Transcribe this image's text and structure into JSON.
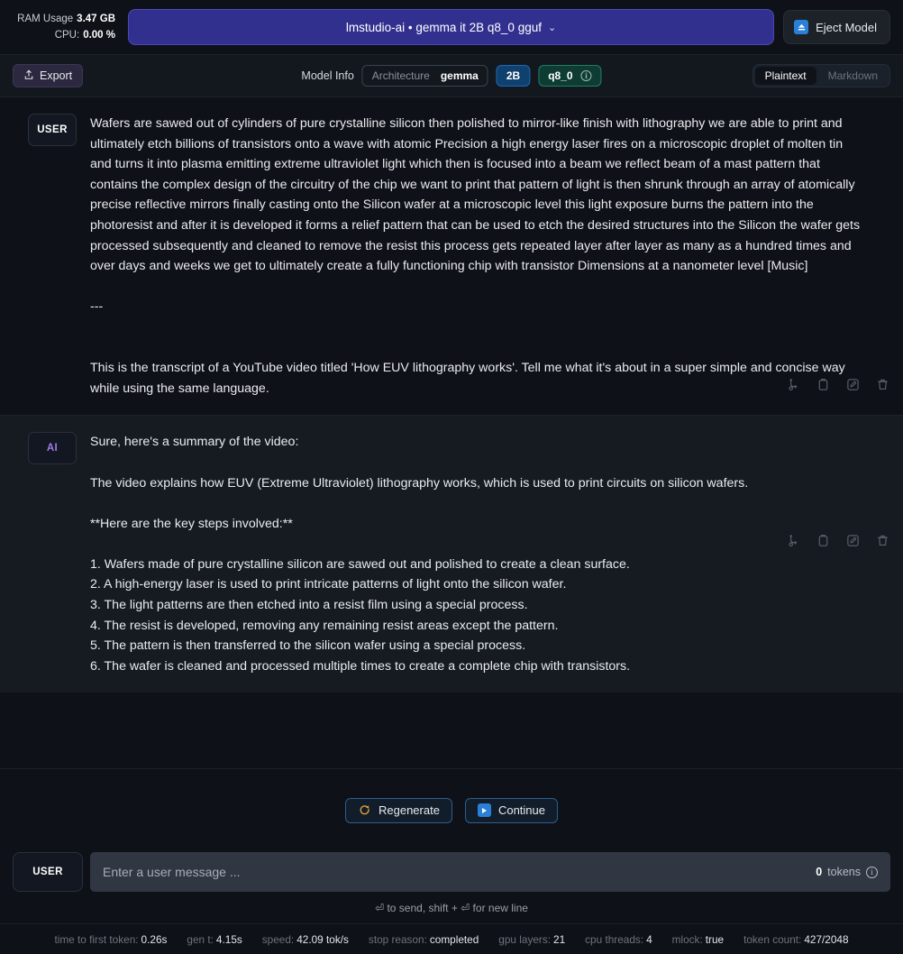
{
  "topbar": {
    "ram_label": "RAM Usage",
    "ram_value": "3.47 GB",
    "cpu_label": "CPU:",
    "cpu_value": "0.00 %",
    "model_name": "lmstudio-ai • gemma it 2B q8_0 gguf",
    "model_chevron": "⌄",
    "eject_label": "Eject Model",
    "eject_icon": "eject-icon"
  },
  "subbar": {
    "export_label": "Export",
    "export_icon": "upload-icon",
    "model_info_label": "Model Info",
    "arch_key": "Architecture",
    "arch_value": "gemma",
    "param_chip": "2B",
    "quant_chip": "q8_0",
    "quant_info_icon": "info-icon",
    "view_modes": [
      "Plaintext",
      "Markdown"
    ],
    "active_view_mode": "Plaintext"
  },
  "messages": [
    {
      "role": "USER",
      "role_style": "user",
      "text": "Wafers are sawed out of cylinders of pure crystalline silicon then polished to mirror-like finish with lithography we are able to print and ultimately etch billions of transistors onto a wave with atomic Precision a high energy laser fires on a microscopic droplet of molten tin and turns it into plasma emitting extreme ultraviolet light which then is focused into a beam we reflect beam of a mast pattern that contains the complex design of the circuitry of the chip we want to print that pattern of light is then shrunk through an array of atomically precise reflective mirrors finally casting onto the Silicon wafer at a microscopic level this light exposure burns the pattern into the photoresist and after it is developed it forms a relief pattern that can be used to etch the desired structures into the Silicon the wafer gets processed subsequently and cleaned to remove the resist this process gets repeated layer after layer as many as a hundred times and over days and weeks we get to ultimately create a fully functioning chip with transistor Dimensions at a nanometer level [Music]\n\n---\n\n\nThis is the transcript of a YouTube video titled 'How EUV lithography works'. Tell me what it's about in a super simple and concise way while using the same language."
    },
    {
      "role": "AI",
      "role_style": "ai",
      "text": "Sure, here's a summary of the video:\n\nThe video explains how EUV (Extreme Ultraviolet) lithography works, which is used to print circuits on silicon wafers.\n\n**Here are the key steps involved:**\n\n1. Wafers made of pure crystalline silicon are sawed out and polished to create a clean surface.\n2. A high-energy laser is used to print intricate patterns of light onto the silicon wafer.\n3. The light patterns are then etched into a resist film using a special process.\n4. The resist is developed, removing any remaining resist areas except the pattern.\n5. The pattern is then transferred to the silicon wafer using a special process.\n6. The wafer is cleaned and processed multiple times to create a complete chip with transistors."
    }
  ],
  "message_actions": [
    {
      "name": "branch-icon",
      "title": "Branch"
    },
    {
      "name": "copy-icon",
      "title": "Copy"
    },
    {
      "name": "edit-icon",
      "title": "Edit"
    },
    {
      "name": "delete-icon",
      "title": "Delete"
    }
  ],
  "regen": {
    "regenerate_label": "Regenerate",
    "regenerate_icon": "refresh-icon",
    "continue_label": "Continue",
    "continue_icon": "play-icon"
  },
  "composer": {
    "role_badge": "USER",
    "placeholder": "Enter a user message ...",
    "token_count": "0",
    "token_label": "tokens",
    "token_info_icon": "info-icon",
    "send_hint": "⏎ to send, shift + ⏎ for new line"
  },
  "status": [
    {
      "key": "time to first token:",
      "value": "0.26s"
    },
    {
      "key": "gen t:",
      "value": "4.15s"
    },
    {
      "key": "speed:",
      "value": "42.09 tok/s"
    },
    {
      "key": "stop reason:",
      "value": "completed"
    },
    {
      "key": "gpu layers:",
      "value": "21"
    },
    {
      "key": "cpu threads:",
      "value": "4"
    },
    {
      "key": "mlock:",
      "value": "true"
    },
    {
      "key": "token count:",
      "value": "427/2048"
    }
  ],
  "colors": {
    "accent_purple": "#32308f",
    "accent_blue": "#2a80d8",
    "accent_green": "#1f7f66",
    "accent_orange": "#e8a33d",
    "ai_role": "#9f7bea",
    "bg": "#0e1117",
    "bg_ai": "#161b22"
  }
}
